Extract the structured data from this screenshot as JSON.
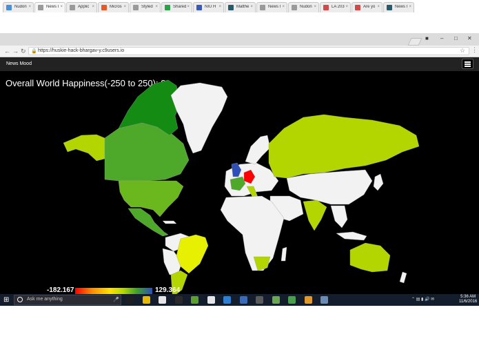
{
  "browser": {
    "tabs": [
      {
        "label": "Nudon",
        "color": "#4a90d9"
      },
      {
        "label": "News I",
        "color": "#9a9a9a",
        "active": true
      },
      {
        "label": "Applic",
        "color": "#9a9a9a"
      },
      {
        "label": "Micros",
        "color": "#e65a2a"
      },
      {
        "label": "Styled",
        "color": "#9a9a9a"
      },
      {
        "label": "Shared",
        "color": "#2aa24a"
      },
      {
        "label": "NIU H",
        "color": "#3a5ab8"
      },
      {
        "label": "Matthe",
        "color": "#2a5a6a"
      },
      {
        "label": "News I",
        "color": "#9a9a9a"
      },
      {
        "label": "Nudon",
        "color": "#9a9a9a"
      },
      {
        "label": "LA 203",
        "color": "#d04a4a"
      },
      {
        "label": "Are yo",
        "color": "#d04a4a"
      },
      {
        "label": "News I",
        "color": "#2a5a6a"
      }
    ],
    "url": "https://huskie-hack-bhargav-y.c9users.io"
  },
  "app": {
    "brand": "News Mood",
    "headline": "Overall World Happiness(-250 to 250): 8"
  },
  "legend": {
    "min": "-182.167",
    "max": "129.364"
  },
  "colors": {
    "no_data": "#f2f2f2",
    "dark_green": "#148c14",
    "green": "#4ea82a",
    "mid_green": "#6ab81e",
    "yellow_green": "#b4d600",
    "yellow": "#e6f000",
    "red": "#ff0000",
    "blue": "#2e4fb8"
  },
  "taskbar": {
    "search_placeholder": "Ask me anything",
    "time": "5:36 AM",
    "date": "11/6/2016"
  }
}
